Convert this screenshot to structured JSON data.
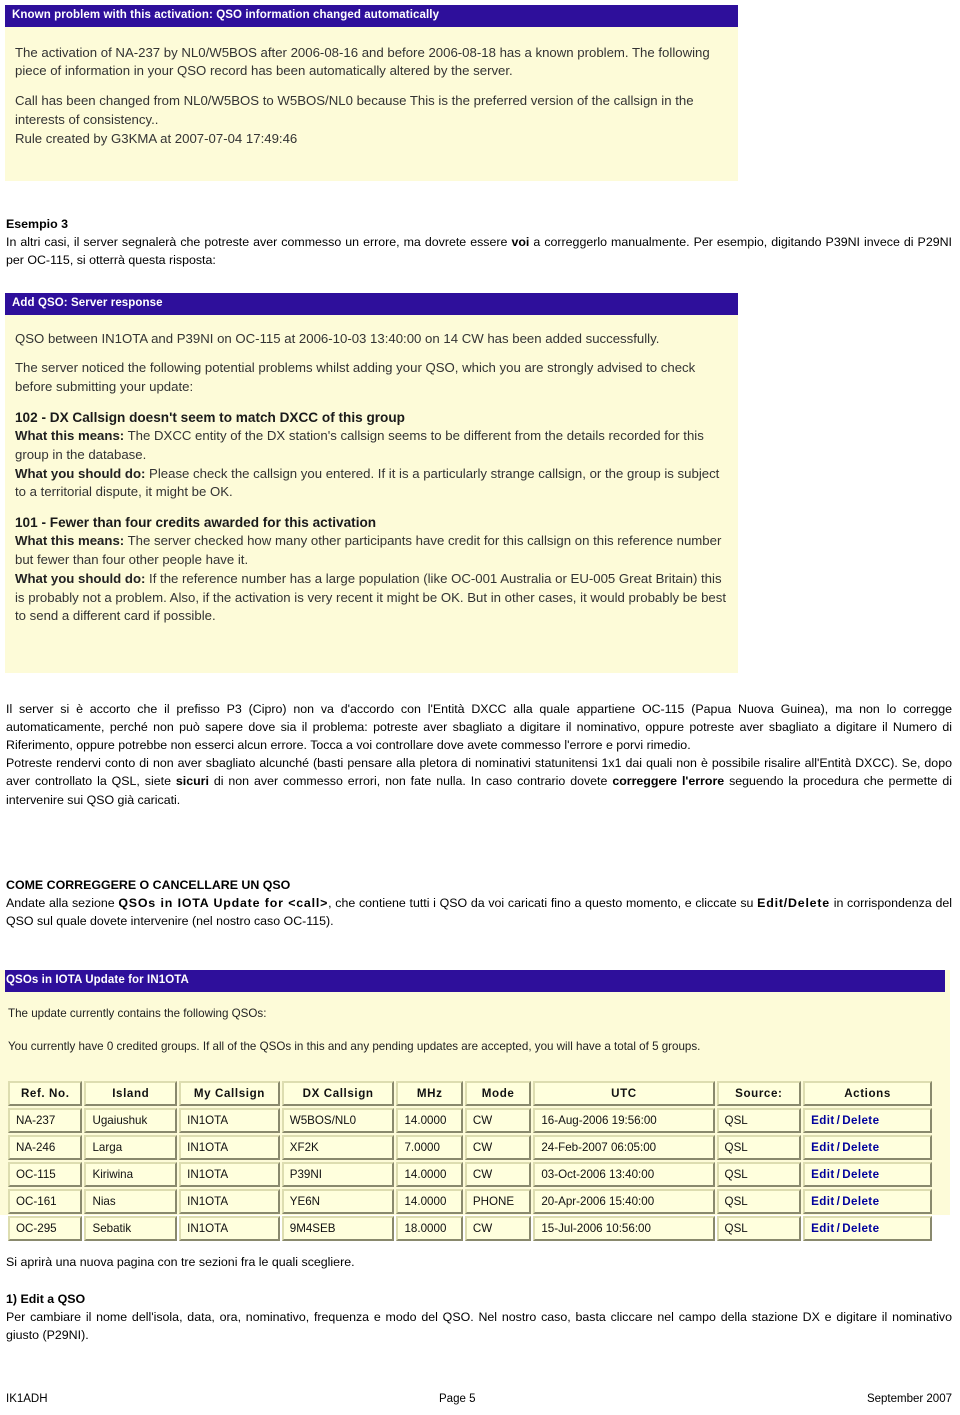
{
  "screenshot_known_problem": {
    "header": "Known problem with this activation: QSO information changed automatically",
    "para1": "The activation of NA-237 by NL0/W5BOS after 2006-08-16 and before 2006-08-18 has a known problem. The following piece of information in your QSO record has been automatically altered by the server.",
    "para2": "Call has been changed from NL0/W5BOS to W5BOS/NL0 because This is the preferred version of the callsign in the interests of consistency..",
    "para3": "Rule created by G3KMA at 2007-07-04 17:49:46"
  },
  "doc_esempio3": {
    "heading": "Esempio 3",
    "line1_a": "In altri casi, il server segnalerà che potreste aver commesso un errore, ma dovrete essere ",
    "line1_bold": "voi",
    "line1_b": " a correggerlo manualmente. Per esempio, digitando P39NI invece di P29NI per OC-115, si otterrà questa risposta:"
  },
  "screenshot_server_response": {
    "header": "Add QSO: Server response",
    "para_success": "QSO between IN1OTA and P39NI on OC-115 at 2006-10-03 13:40:00 on 14 CW has been added successfully.",
    "para_notice": "The server noticed the following potential problems whilst adding your QSO, which you are strongly advised to check before submitting your update:",
    "error_102": {
      "title": "102 - DX Callsign doesn't seem to match DXCC of this group",
      "means_label": "What this means:",
      "means_text": " The DXCC entity of the DX station's callsign seems to be different from the details recorded for this group in the database.",
      "do_label": "What you should do:",
      "do_text": " Please check the callsign you entered. If it is a particularly strange callsign, or the group is subject to a territorial dispute, it might be OK."
    },
    "error_101": {
      "title": "101 - Fewer than four credits awarded for this activation",
      "means_label": "What this means:",
      "means_text": " The server checked how many other participants have credit for this callsign on this reference number but fewer than four other people have it.",
      "do_label": "What you should do:",
      "do_text": " If the reference number has a large population (like OC-001 Australia or EU-005 Great Britain) this is probably not a problem. Also, if the activation is very recent it might be OK. But in other cases, it would probably be best to send a different card if possible."
    }
  },
  "doc_server_explain": {
    "para1": "Il server si è accorto che il prefisso P3 (Cipro) non va d'accordo con l'Entità DXCC alla quale appartiene OC-115 (Papua Nuova Guinea), ma non lo corregge automaticamente, perché non può sapere dove sia il problema: potreste aver sbagliato a digitare il nominativo, oppure potreste aver sbagliato a digitare il Numero di Riferimento, oppure potrebbe non esserci alcun errore. Tocca a voi controllare dove avete commesso l'errore e porvi rimedio.",
    "para2_a": "Potreste rendervi conto di non aver sbagliato alcunché (basti pensare alla pletora di nominativi statunitensi 1x1 dai quali non è possibile risalire all'Entità DXCC). Se, dopo aver controllato la QSL, siete ",
    "para2_bold1": "sicuri",
    "para2_b": " di non aver commesso errori, non fate nulla. In caso contrario dovete ",
    "para2_bold2": "correggere l'errore",
    "para2_c": " seguendo la procedura che permette di intervenire sui QSO già caricati."
  },
  "doc_come_correggere": {
    "heading": "COME CORREGGERE O CANCELLARE UN QSO",
    "body_a": "Andate alla sezione ",
    "body_bold1": "QSOs in IOTA Update for <call>",
    "body_b": ", che contiene tutti i QSO da voi caricati fino a questo momento, e cliccate su ",
    "body_bold2": "Edit/Delete",
    "body_c": " in corrispondenza del QSO sul quale dovete intervenire (nel nostro caso OC-115)."
  },
  "screenshot_qso_update": {
    "header": "QSOs in IOTA Update for IN1OTA",
    "para1": "The update currently contains the following QSOs:",
    "para2": "You currently have 0 credited groups. If all of the QSOs in this and any pending updates are accepted, you will have a total of 5 groups.",
    "table": {
      "columns": [
        "Ref. No.",
        "Island",
        "My Callsign",
        "DX Callsign",
        "MHz",
        "Mode",
        "UTC",
        "Source:",
        "Actions"
      ],
      "action_edit": "Edit",
      "action_sep": "/",
      "action_delete": "Delete",
      "rows": [
        {
          "ref": "NA-237",
          "island": "Ugaiushuk",
          "my_callsign": "IN1OTA",
          "dx_callsign": "W5BOS/NL0",
          "mhz": "14.0000",
          "mode": "CW",
          "utc": "16-Aug-2006 19:56:00",
          "source": "QSL"
        },
        {
          "ref": "NA-246",
          "island": "Larga",
          "my_callsign": "IN1OTA",
          "dx_callsign": "XF2K",
          "mhz": "7.0000",
          "mode": "CW",
          "utc": "24-Feb-2007 06:05:00",
          "source": "QSL"
        },
        {
          "ref": "OC-115",
          "island": "Kiriwina",
          "my_callsign": "IN1OTA",
          "dx_callsign": "P39NI",
          "mhz": "14.0000",
          "mode": "CW",
          "utc": "03-Oct-2006 13:40:00",
          "source": "QSL"
        },
        {
          "ref": "OC-161",
          "island": "Nias",
          "my_callsign": "IN1OTA",
          "dx_callsign": "YE6N",
          "mhz": "14.0000",
          "mode": "PHONE",
          "utc": "20-Apr-2006 15:40:00",
          "source": "QSL"
        },
        {
          "ref": "OC-295",
          "island": "Sebatik",
          "my_callsign": "IN1OTA",
          "dx_callsign": "9M4SEB",
          "mhz": "18.0000",
          "mode": "CW",
          "utc": "15-Jul-2006 10:56:00",
          "source": "QSL"
        }
      ]
    }
  },
  "doc_nuova_pagina": {
    "text": "Si aprirà una nuova pagina con tre sezioni fra le quali scegliere."
  },
  "doc_edit_qso": {
    "heading": "1) Edit a QSO",
    "body": "Per cambiare il nome dell'isola, data, ora, nominativo, frequenza e modo del QSO. Nel nostro caso, basta cliccare nel campo della stazione DX e digitare il nominativo giusto (P29NI)."
  },
  "footer": {
    "left": "IK1ADH",
    "center": "Page 5",
    "right": "September 2007"
  },
  "colors": {
    "panel_header_bg": "#2e0f9b",
    "panel_body_bg": "#fdfbd8",
    "table_cell_bg": "#ffffdd",
    "table_border": "#ddddb0",
    "link_blue": "#00009c"
  }
}
